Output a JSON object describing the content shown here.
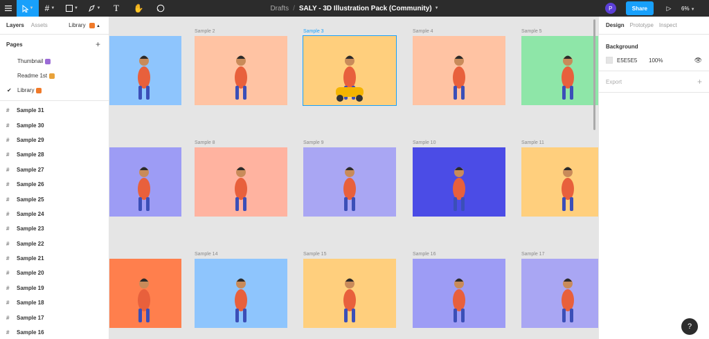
{
  "toolbar": {
    "doc_drafts": "Drafts",
    "doc_name": "SALY - 3D Illustration Pack (Community)",
    "avatar_letter": "P",
    "share_label": "Share",
    "zoom": "6%"
  },
  "left_panel": {
    "tabs": [
      "Layers",
      "Assets"
    ],
    "library": "Library",
    "pages_title": "Pages",
    "pages": [
      {
        "label": "Thumbnail",
        "emoji_color": "#9b6bd6",
        "current": false
      },
      {
        "label": "Readme 1st",
        "emoji_color": "#e8a23a",
        "current": false
      },
      {
        "label": "Library",
        "emoji_color": "#f07a2a",
        "current": true
      }
    ],
    "layers": [
      "Sample 31",
      "Sample 30",
      "Sample 29",
      "Sample 28",
      "Sample 27",
      "Sample 26",
      "Sample 25",
      "Sample 24",
      "Sample 23",
      "Sample 22",
      "Sample 21",
      "Sample 20",
      "Sample 19",
      "Sample 18",
      "Sample 17",
      "Sample 16"
    ]
  },
  "canvas": {
    "frames": [
      {
        "label": "",
        "color": "#8ec5fd",
        "selected": false
      },
      {
        "label": "Sample 2",
        "color": "#ffc3a3",
        "selected": false
      },
      {
        "label": "Sample 3",
        "color": "#ffcf7d",
        "selected": true
      },
      {
        "label": "Sample 4",
        "color": "#ffc3a3",
        "selected": false
      },
      {
        "label": "Sample 5",
        "color": "#8ee6a8",
        "selected": false
      },
      {
        "label": "",
        "color": "#9d9cf5",
        "selected": false
      },
      {
        "label": "Sample 8",
        "color": "#ffb3a0",
        "selected": false
      },
      {
        "label": "Sample 9",
        "color": "#a9a6f3",
        "selected": false
      },
      {
        "label": "Sample 10",
        "color": "#4b4ce6",
        "selected": false
      },
      {
        "label": "Sample 11",
        "color": "#ffcf7d",
        "selected": false
      },
      {
        "label": "",
        "color": "#ff7f4d",
        "selected": false
      },
      {
        "label": "Sample 14",
        "color": "#8ec5fd",
        "selected": false
      },
      {
        "label": "Sample 15",
        "color": "#ffcf7d",
        "selected": false
      },
      {
        "label": "Sample 16",
        "color": "#9d9cf5",
        "selected": false
      },
      {
        "label": "Sample 17",
        "color": "#a9a6f3",
        "selected": false
      }
    ]
  },
  "right_panel": {
    "tabs": [
      "Design",
      "Prototype",
      "Inspect"
    ],
    "background_title": "Background",
    "bg_hex": "E5E5E5",
    "bg_opacity": "100%",
    "export_title": "Export"
  },
  "help": "?"
}
